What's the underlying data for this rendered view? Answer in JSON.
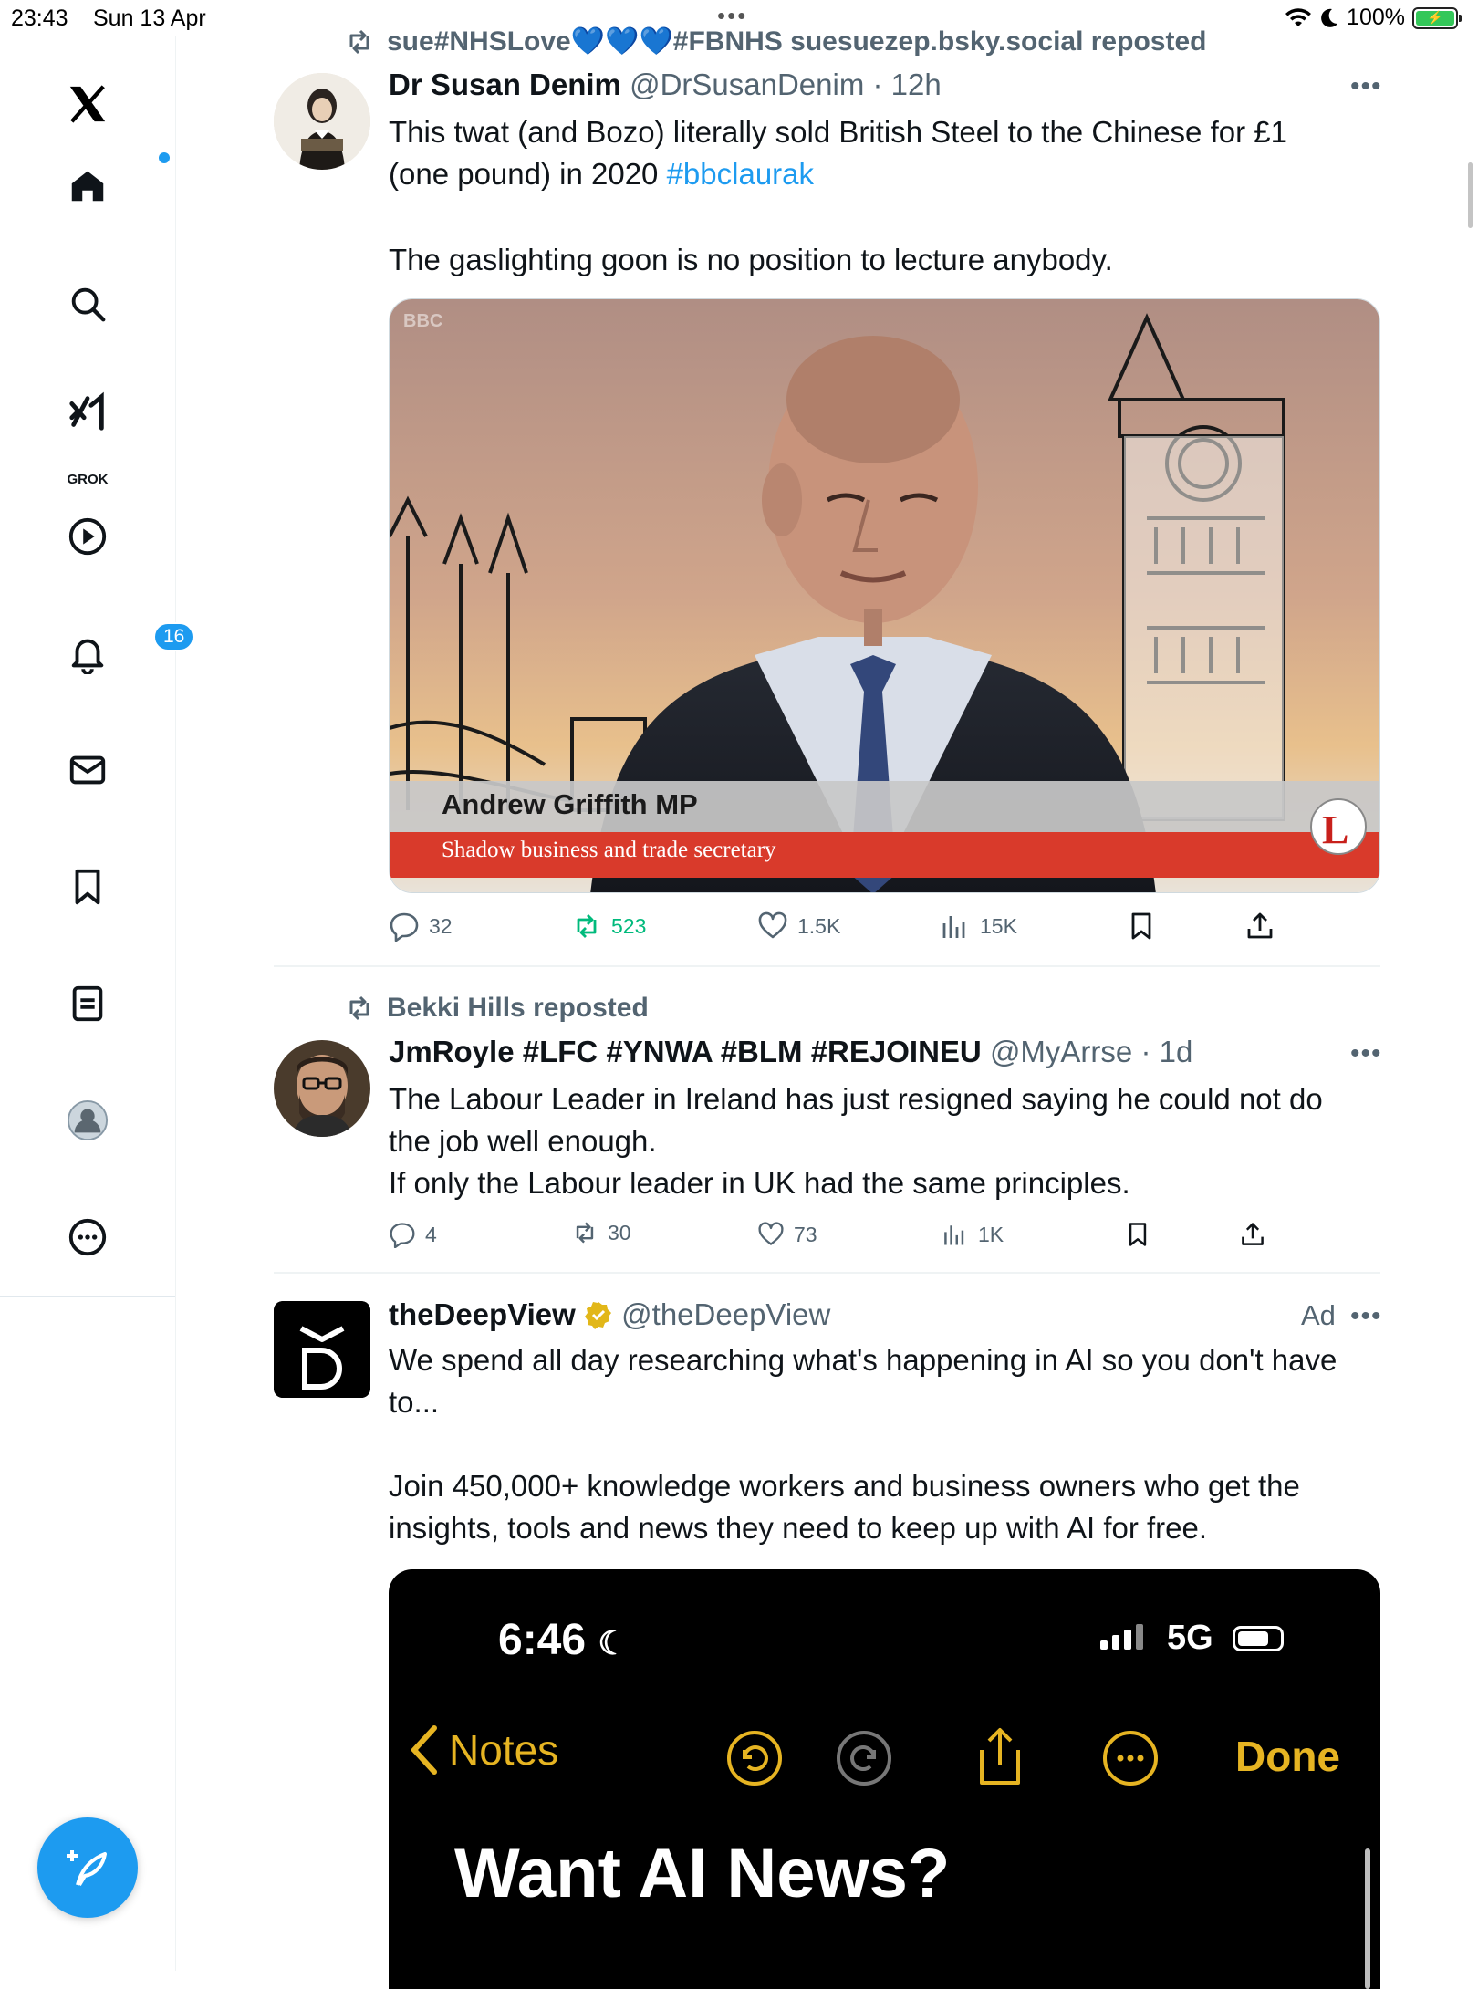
{
  "status_bar": {
    "time": "23:43",
    "date": "Sun 13 Apr",
    "battery": "100%"
  },
  "sidebar": {
    "grok_label": "GROK",
    "notifications_badge": "16"
  },
  "tweets": [
    {
      "repost_by": "sue#NHSLove💙💙💙#FBNHS suesuezep.bsky.social reposted",
      "name": "Dr Susan Denim",
      "handle": "@DrSusanDenim",
      "time": "12h",
      "text_1": "This twat (and Bozo) literally sold British Steel to the Chinese for £1\n(one pound) in 2020 ",
      "hashtag": "#bbclaurak",
      "text_2": "The gaslighting goon is no position to lecture anybody.",
      "media": {
        "lower_third_name": "Andrew Griffith MP",
        "lower_third_title": "Shadow business and trade secretary",
        "channel": "BBC"
      },
      "stats": {
        "replies": "32",
        "reposts": "523",
        "likes": "1.5K",
        "views": "15K"
      }
    },
    {
      "repost_by": "Bekki Hills reposted",
      "name": "JmRoyle #LFC #YNWA #BLM #REJOINEU",
      "handle": "@MyArrse",
      "time": "1d",
      "text": "The Labour Leader in Ireland has just resigned saying he could not do\nthe job well enough.\nIf only the Labour leader in UK had the same principles.",
      "stats": {
        "replies": "4",
        "reposts": "30",
        "likes": "73",
        "views": "1K"
      }
    },
    {
      "name": "theDeepView",
      "handle": "@theDeepView",
      "ad_label": "Ad",
      "text_1": "We spend all day researching what's happening in AI so you don't have\nto...",
      "text_2": "Join 450,000+ knowledge workers and business owners who get the\ninsights, tools and news they need to keep up with AI for free.",
      "media": {
        "phone_time": "6:46",
        "network": "5G",
        "back_label": "Notes",
        "done_label": "Done",
        "headline": "Want AI News?"
      }
    }
  ],
  "colors": {
    "accent": "#1d9bf0",
    "repost_green": "#00ba7c",
    "muted": "#536471",
    "verified_gold": "#e2b719",
    "notes_yellow": "#e6b422"
  }
}
